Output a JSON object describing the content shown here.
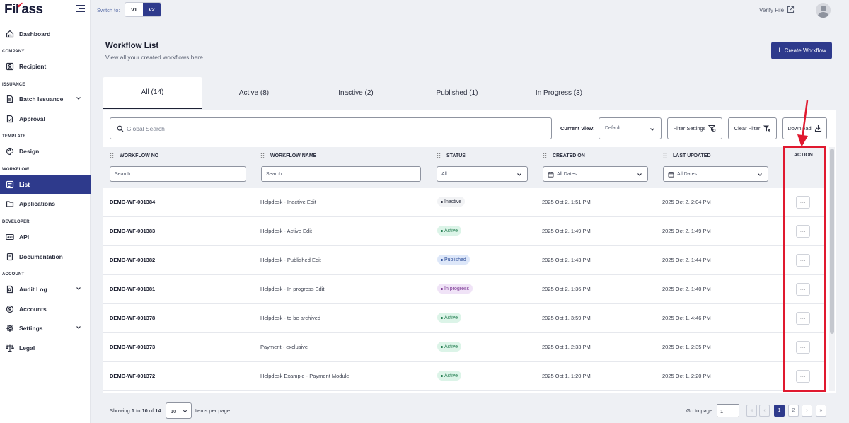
{
  "brand": {
    "logo_text_a": "Fil",
    "logo_text_b": "ass"
  },
  "sidebar": {
    "items": [
      {
        "label": "Dashboard",
        "icon": "home-icon"
      },
      {
        "label": "Recipient",
        "icon": "user-card-icon"
      },
      {
        "label": "Batch Issuance",
        "icon": "document-icon"
      },
      {
        "label": "Approval",
        "icon": "approval-icon"
      },
      {
        "label": "Design",
        "icon": "palette-icon"
      },
      {
        "label": "List",
        "icon": "list-icon"
      },
      {
        "label": "Applications",
        "icon": "folder-icon"
      },
      {
        "label": "API",
        "icon": "api-icon"
      },
      {
        "label": "Documentation",
        "icon": "book-icon"
      },
      {
        "label": "Audit Log",
        "icon": "audit-icon"
      },
      {
        "label": "Accounts",
        "icon": "account-icon"
      },
      {
        "label": "Settings",
        "icon": "gear-icon"
      },
      {
        "label": "Legal",
        "icon": "scale-icon"
      }
    ],
    "sections": [
      "COMPANY",
      "ISSUANCE",
      "TEMPLATE",
      "WORKFLOW",
      "DEVELOPER",
      "ACCOUNT"
    ],
    "active_item": "List"
  },
  "topbar": {
    "switch_label": "Switch to:",
    "versions": [
      "v1",
      "v2"
    ],
    "selected_version": "v2",
    "verify_label": "Verify File"
  },
  "page": {
    "title": "Workflow List",
    "subtitle": "View all your created workflows here",
    "create_label": "Create Workflow"
  },
  "tabs": [
    {
      "label": "All (14)",
      "active": true
    },
    {
      "label": "Active (8)",
      "active": false
    },
    {
      "label": "Inactive (2)",
      "active": false
    },
    {
      "label": "Published (1)",
      "active": false
    },
    {
      "label": "In Progress (3)",
      "active": false
    }
  ],
  "toolbar": {
    "search_placeholder": "Global Search",
    "current_view_label": "Current View:",
    "current_view_value": "Default",
    "filter_settings_label": "Filter Settings",
    "clear_filter_label": "Clear Filter",
    "download_label": "Download"
  },
  "table": {
    "columns": [
      "WORKFLOW NO",
      "WORKFLOW NAME",
      "STATUS",
      "CREATED ON",
      "LAST UPDATED",
      "ACTION"
    ],
    "filters": {
      "no_placeholder": "Search",
      "name_placeholder": "Search",
      "status_value": "All",
      "created_value": "All Dates",
      "updated_value": "All Dates"
    },
    "action_label": "···",
    "rows": [
      {
        "no": "DEMO-WF-001384",
        "name": "Helpdesk - Inactive Edit",
        "status": "Inactive",
        "status_key": "inactive",
        "created": "2025 Oct 2, 1:51 PM",
        "updated": "2025 Oct 2, 2:04 PM"
      },
      {
        "no": "DEMO-WF-001383",
        "name": "Helpdesk - Active Edit",
        "status": "Active",
        "status_key": "active",
        "created": "2025 Oct 2, 1:49 PM",
        "updated": "2025 Oct 2, 1:49 PM"
      },
      {
        "no": "DEMO-WF-001382",
        "name": "Helpdesk - Published Edit",
        "status": "Published",
        "status_key": "published",
        "created": "2025 Oct 2, 1:43 PM",
        "updated": "2025 Oct 2, 1:44 PM"
      },
      {
        "no": "DEMO-WF-001381",
        "name": "Helpdesk - In progress Edit",
        "status": "In progress",
        "status_key": "inprogress",
        "created": "2025 Oct 2, 1:36 PM",
        "updated": "2025 Oct 2, 1:40 PM"
      },
      {
        "no": "DEMO-WF-001378",
        "name": "Helpdesk - to be archived",
        "status": "Active",
        "status_key": "active",
        "created": "2025 Oct 1, 3:59 PM",
        "updated": "2025 Oct 1, 4:46 PM"
      },
      {
        "no": "DEMO-WF-001373",
        "name": "Payment - exclusive",
        "status": "Active",
        "status_key": "active",
        "created": "2025 Oct 1, 2:33 PM",
        "updated": "2025 Oct 1, 2:35 PM"
      },
      {
        "no": "DEMO-WF-001372",
        "name": "Helpdesk Example - Payment Module",
        "status": "Active",
        "status_key": "active",
        "created": "2025 Oct 1, 1:20 PM",
        "updated": "2025 Oct 1, 2:20 PM"
      }
    ]
  },
  "footer": {
    "showing_prefix": "Showing ",
    "showing_from": "1",
    "showing_to_word": " to ",
    "showing_to": "10",
    "showing_of_word": " of ",
    "showing_total": "14",
    "items_per_page_value": "10",
    "items_per_page_label": "Items per page",
    "goto_label": "Go to page",
    "goto_value": "1",
    "pages": [
      "1",
      "2"
    ],
    "current_page": "1",
    "first_symbol": "«",
    "prev_symbol": "‹",
    "next_symbol": "›",
    "last_symbol": "»"
  },
  "colors": {
    "primary": "#2e3a8c",
    "highlight": "#e0192f",
    "active_badge": "#dcf4e8",
    "published_badge": "#dde7f9",
    "inprogress_badge": "#f0e3f7"
  }
}
